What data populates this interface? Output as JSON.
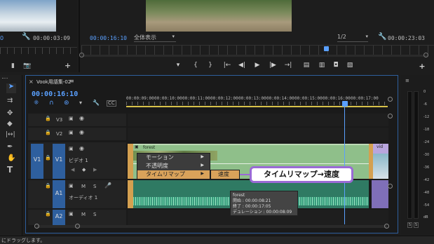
{
  "source_monitor": {
    "timecode": "00:00:03:09"
  },
  "program_monitor": {
    "timecode": "00:00:16:10",
    "fit": "全体表示",
    "quality": "1/2",
    "duration": "00:00:23:03"
  },
  "sequence": {
    "close": "×",
    "name": "Vook用語集-02",
    "menu": "≡",
    "timecode": "00:00:16:10"
  },
  "ruler": [
    "00:00:09:00",
    "00:00:10:00",
    "00:00:11:00",
    "00:00:12:00",
    "00:00:13:00",
    "00:00:14:00",
    "00:00:15:00",
    "00:00:16:00",
    "00:00:17:00"
  ],
  "tracks": {
    "v3": {
      "name": "V3"
    },
    "v2": {
      "name": "V2"
    },
    "v1": {
      "src": "V1",
      "name": "V1",
      "label": "ビデオ 1"
    },
    "a1": {
      "name": "A1",
      "m": "M",
      "s": "S",
      "label": "オーディオ 1"
    },
    "a2": {
      "name": "A2"
    }
  },
  "clip": {
    "video_name": "forest",
    "right_name": "vid"
  },
  "context_menu": {
    "items": [
      "モーション",
      "不透明度",
      "タイムリマップ"
    ],
    "submenu": "速度"
  },
  "callout": "タイムリマップ→速度",
  "tooltip": {
    "name": "forest",
    "start": "開始 : 00:00:08:21",
    "end": "終了 : 00:00:17:05",
    "duration": "デュレーション : 00:00:08:09"
  },
  "meter": {
    "scale": [
      "0",
      "-6",
      "-12",
      "-18",
      "-24",
      "-30",
      "-36",
      "-42",
      "-48",
      "-54",
      "dB"
    ],
    "solo": "S"
  },
  "status": "にドラッグします。",
  "colors": {
    "accent": "#5aa0ff",
    "video_clip": "#8fbf8a",
    "audio_clip": "#3a9a7e",
    "callout_border": "#9a6ad6"
  }
}
